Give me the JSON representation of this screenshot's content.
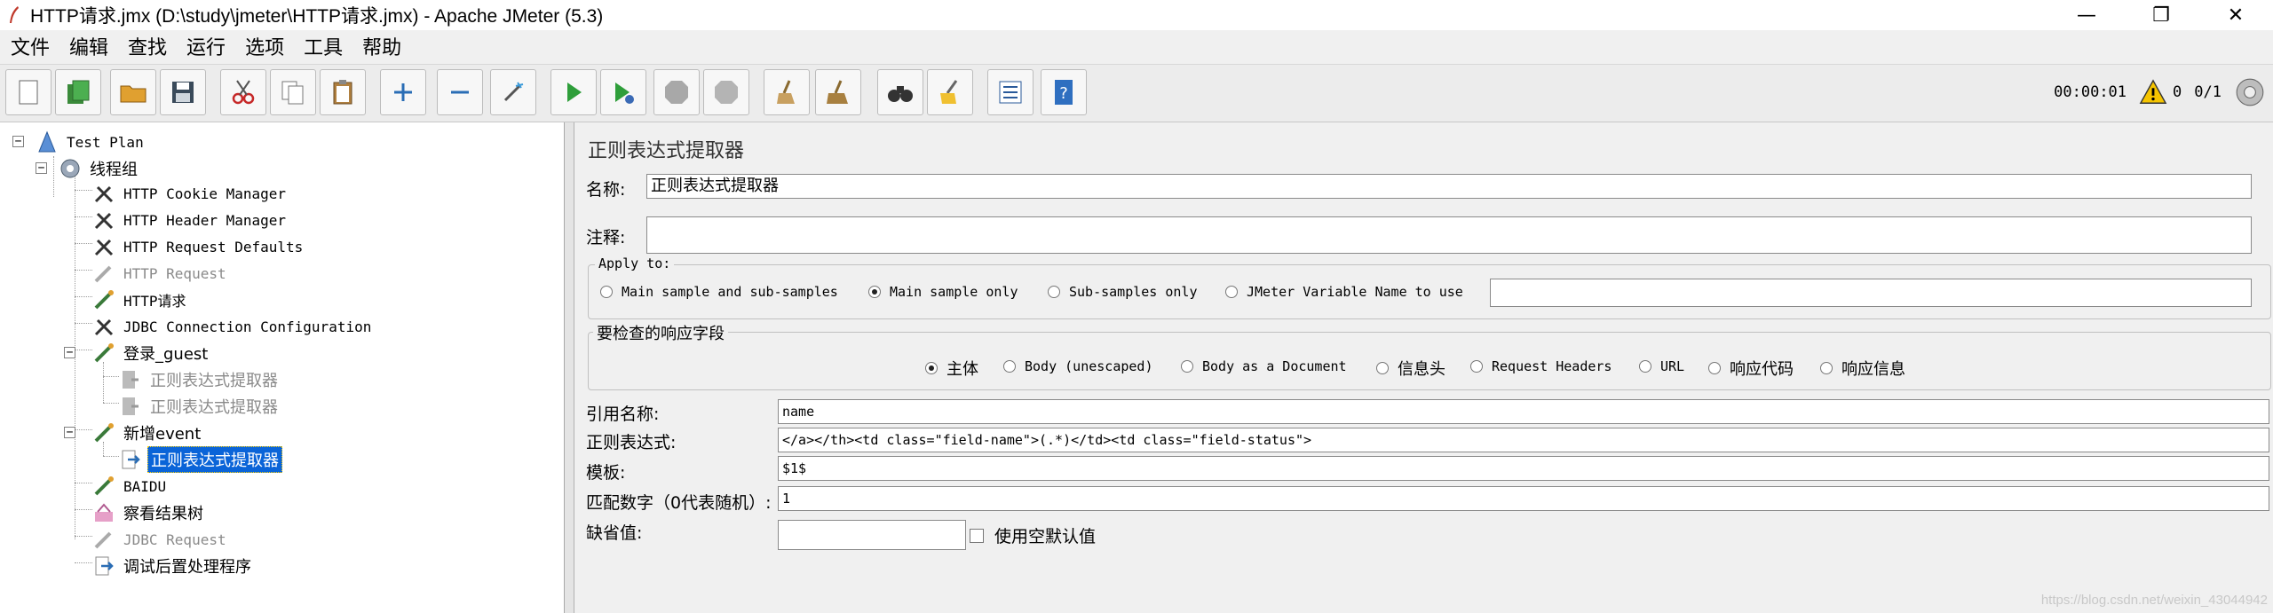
{
  "window": {
    "title": "HTTP请求.jmx (D:\\study\\jmeter\\HTTP请求.jmx) - Apache JMeter (5.3)",
    "controls": [
      "—",
      "❐",
      "✕"
    ]
  },
  "menu": {
    "items": [
      "文件",
      "编辑",
      "查找",
      "运行",
      "选项",
      "工具",
      "帮助"
    ]
  },
  "toolbar": {
    "status": {
      "elapsed": "00:00:01",
      "warnings": "0",
      "threads": "0/1"
    }
  },
  "tree": {
    "nodes": [
      {
        "label": "Test Plan",
        "icon": "test-plan-icon",
        "state": "normal"
      },
      {
        "label": "线程组",
        "icon": "thread-group-icon",
        "state": "normal"
      },
      {
        "label": "HTTP Cookie Manager",
        "icon": "config-tool-icon",
        "state": "normal"
      },
      {
        "label": "HTTP Header Manager",
        "icon": "config-tool-icon",
        "state": "normal"
      },
      {
        "label": "HTTP Request Defaults",
        "icon": "config-tool-icon",
        "state": "normal"
      },
      {
        "label": "HTTP Request",
        "icon": "sampler-icon",
        "state": "disabled"
      },
      {
        "label": "HTTP请求",
        "icon": "sampler-icon",
        "state": "normal"
      },
      {
        "label": "JDBC Connection Configuration",
        "icon": "config-tool-icon",
        "state": "normal"
      },
      {
        "label": "登录_guest",
        "icon": "sampler-icon",
        "state": "normal"
      },
      {
        "label": "正则表达式提取器",
        "icon": "post-processor-icon",
        "state": "disabled"
      },
      {
        "label": "正则表达式提取器",
        "icon": "post-processor-icon",
        "state": "disabled"
      },
      {
        "label": "新增event",
        "icon": "sampler-icon",
        "state": "normal"
      },
      {
        "label": "正则表达式提取器",
        "icon": "post-processor-icon",
        "state": "selected"
      },
      {
        "label": "BAIDU",
        "icon": "sampler-icon",
        "state": "normal"
      },
      {
        "label": "察看结果树",
        "icon": "listener-icon",
        "state": "normal"
      },
      {
        "label": "JDBC Request",
        "icon": "sampler-icon",
        "state": "disabled"
      },
      {
        "label": "调试后置处理程序",
        "icon": "post-processor-icon",
        "state": "normal"
      }
    ]
  },
  "editor": {
    "title": "正则表达式提取器",
    "name_label": "名称:",
    "name_value": "正则表达式提取器",
    "comment_label": "注释:",
    "comment_value": "",
    "apply_to": {
      "legend": "Apply to:",
      "options": [
        "Main sample and sub-samples",
        "Main sample only",
        "Sub-samples only",
        "JMeter Variable Name to use"
      ],
      "selected": "Main sample only",
      "variable_value": ""
    },
    "field_to_check": {
      "legend": "要检查的响应字段",
      "options": [
        "主体",
        "Body (unescaped)",
        "Body as a Document",
        "信息头",
        "Request Headers",
        "URL",
        "响应代码",
        "响应信息"
      ],
      "selected": "主体"
    },
    "ref_name_label": "引用名称:",
    "ref_name_value": "name",
    "regex_label": "正则表达式:",
    "regex_value": "</a></th><td class=\"field-name\">(.*)</td><td class=\"field-status\">",
    "template_label": "模板:",
    "template_value": "$1$",
    "match_no_label": "匹配数字（0代表随机）:",
    "match_no_value": "1",
    "default_label": "缺省值:",
    "default_value": "",
    "use_empty_label": "使用空默认值"
  },
  "watermark": "https://blog.csdn.net/weixin_43044942"
}
